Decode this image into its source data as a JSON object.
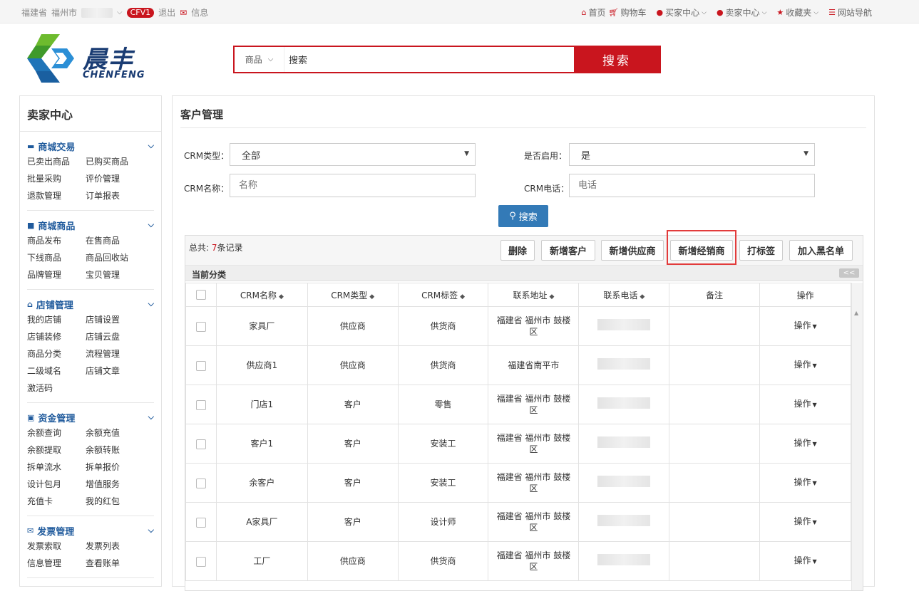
{
  "topbar": {
    "province": "福建省",
    "city": "福州市",
    "badge": "CFV1",
    "logout": "退出",
    "message": "信息",
    "nav": [
      "首页",
      "购物车",
      "买家中心",
      "卖家中心",
      "收藏夹",
      "网站导航"
    ]
  },
  "logo": {
    "cn": "晨丰",
    "en": "CHENFENG"
  },
  "search": {
    "category": "商品",
    "query": "搜索",
    "button": "搜索"
  },
  "sidebar": {
    "title": "卖家中心",
    "sections": [
      {
        "title": "商城交易",
        "icon": "card-icon",
        "links": [
          "已卖出商品",
          "已购买商品",
          "批量采购",
          "评价管理",
          "退款管理",
          "订单报表"
        ]
      },
      {
        "title": "商城商品",
        "icon": "truck-icon",
        "links": [
          "商品发布",
          "在售商品",
          "下线商品",
          "商品回收站",
          "品牌管理",
          "宝贝管理"
        ]
      },
      {
        "title": "店铺管理",
        "icon": "home-icon",
        "links": [
          "我的店铺",
          "店铺设置",
          "店铺装修",
          "店铺云盘",
          "商品分类",
          "流程管理",
          "二级域名",
          "店铺文章",
          "激活码"
        ]
      },
      {
        "title": "资金管理",
        "icon": "money-icon",
        "links": [
          "余额查询",
          "余额充值",
          "余额提取",
          "余额转账",
          "拆单流水",
          "拆单报价",
          "设计包月",
          "增值服务",
          "充值卡",
          "我的红包"
        ]
      },
      {
        "title": "发票管理",
        "icon": "envelope-icon",
        "links": [
          "发票索取",
          "发票列表",
          "信息管理",
          "查看账单"
        ]
      }
    ]
  },
  "main": {
    "title": "客户管理",
    "filters": {
      "crm_type_label": "CRM类型：",
      "crm_type_value": "全部",
      "enabled_label": "是否启用：",
      "enabled_value": "是",
      "crm_name_label": "CRM名称：",
      "crm_name_placeholder": "名称",
      "crm_phone_label": "CRM电话：",
      "crm_phone_placeholder": "电话",
      "search_button": "搜索"
    },
    "total_prefix": "总共: ",
    "total_count": "7",
    "total_suffix": "条记录",
    "actions": [
      "删除",
      "新增客户",
      "新增供应商",
      "新增经销商",
      "打标签",
      "加入黑名单"
    ],
    "category_label": "当前分类",
    "collapse": "<<",
    "columns": [
      "CRM名称",
      "CRM类型",
      "CRM标签",
      "联系地址",
      "联系电话",
      "备注",
      "操作"
    ],
    "rows": [
      {
        "name": "家具厂",
        "type": "供应商",
        "tag": "供货商",
        "address": "福建省 福州市 鼓楼区",
        "op": "操作"
      },
      {
        "name": "供应商1",
        "type": "供应商",
        "tag": "供货商",
        "address": "福建省南平市",
        "op": "操作"
      },
      {
        "name": "门店1",
        "type": "客户",
        "tag": "零售",
        "address": "福建省 福州市 鼓楼区",
        "op": "操作"
      },
      {
        "name": "客户1",
        "type": "客户",
        "tag": "安装工",
        "address": "福建省 福州市 鼓楼区",
        "op": "操作"
      },
      {
        "name": "余客户",
        "type": "客户",
        "tag": "安装工",
        "address": "福建省 福州市 鼓楼区",
        "op": "操作"
      },
      {
        "name": "A家具厂",
        "type": "客户",
        "tag": "设计师",
        "address": "福建省 福州市 鼓楼区",
        "op": "操作"
      },
      {
        "name": "工厂",
        "type": "供应商",
        "tag": "供货商",
        "address": "福建省 福州市 鼓楼区",
        "op": "操作"
      }
    ]
  }
}
